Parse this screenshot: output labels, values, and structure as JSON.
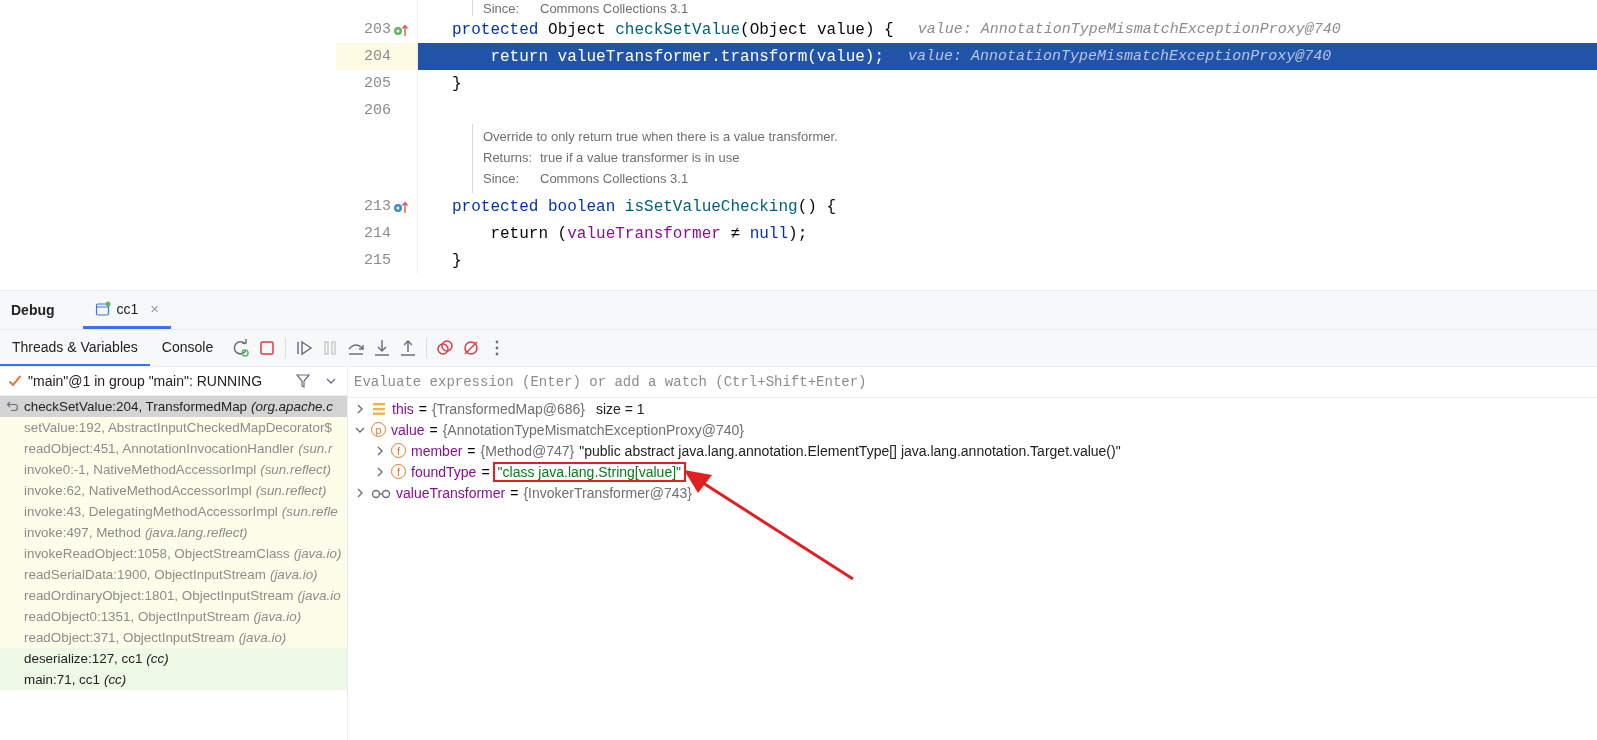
{
  "editor": {
    "lines": [
      {
        "kind": "doc",
        "rows": [
          {
            "label": "Since:",
            "text": "Commons Collections 3.1"
          }
        ]
      },
      {
        "kind": "code",
        "number": "203",
        "marker": {
          "kind": "implements"
        },
        "selected": false,
        "tokens": [
          {
            "text": "protected",
            "kind": "kw"
          },
          {
            "text": " Object ",
            "kind": "plain"
          },
          {
            "text": "checkSetValue",
            "kind": "method"
          },
          {
            "text": "(Object value) {",
            "kind": "plain"
          }
        ],
        "hint": "value: AnnotationTypeMismatchExceptionProxy@740"
      },
      {
        "kind": "code",
        "number": "204",
        "selected": true,
        "tokens": [
          {
            "text": "    return valueTransformer.transform(value);",
            "kind": "plain"
          }
        ],
        "hint": "value: AnnotationTypeMismatchExceptionProxy@740"
      },
      {
        "kind": "code",
        "number": "205",
        "selected": false,
        "tokens": [
          {
            "text": "}",
            "kind": "plain"
          }
        ]
      },
      {
        "kind": "code",
        "number": "206",
        "selected": false
      },
      {
        "kind": "doc",
        "rows": [
          {
            "text": "Override to only return true when there is a value transformer."
          },
          {
            "label": "Returns:",
            "text": "true if a value transformer is in use"
          },
          {
            "label": "Since:",
            "text": "Commons Collections 3.1"
          }
        ]
      },
      {
        "kind": "code",
        "number": "213",
        "marker": {
          "kind": "overrides"
        },
        "selected": false,
        "tokens": [
          {
            "text": "protected boolean",
            "kind": "kw"
          },
          {
            "text": " isSetValueChecking",
            "kind": "method"
          },
          {
            "text": "() {",
            "kind": "plain"
          }
        ]
      },
      {
        "kind": "code",
        "number": "214",
        "selected": false,
        "tokens": [
          {
            "text": "    return (",
            "kind": "plain"
          },
          {
            "text": "valueTransformer",
            "kind": "field"
          },
          {
            "text": " ≠ ",
            "kind": "plain"
          },
          {
            "text": "null",
            "kind": "kw"
          },
          {
            "text": ");",
            "kind": "plain"
          }
        ]
      },
      {
        "kind": "code",
        "number": "215",
        "selected": false,
        "tokens": [
          {
            "text": "}",
            "kind": "plain"
          }
        ]
      }
    ]
  },
  "debug": {
    "title": "Debug",
    "tabs": [
      {
        "label": "cc1",
        "selected": true,
        "close": "×"
      }
    ],
    "subtabs": [
      {
        "label": "Threads & Variables",
        "selected": true
      },
      {
        "label": "Console",
        "selected": false
      }
    ],
    "toolbar": [
      {
        "kind": "rerun",
        "disabled": false
      },
      {
        "kind": "stop",
        "disabled": false
      },
      {
        "kind": "sep"
      },
      {
        "kind": "resume",
        "disabled": false
      },
      {
        "kind": "pause",
        "disabled": true
      },
      {
        "kind": "step-over",
        "disabled": false
      },
      {
        "kind": "step-into",
        "disabled": false
      },
      {
        "kind": "step-out",
        "disabled": false
      },
      {
        "kind": "sep"
      },
      {
        "kind": "breakpoints",
        "disabled": false
      },
      {
        "kind": "mute",
        "disabled": false
      },
      {
        "kind": "more",
        "disabled": false
      }
    ],
    "thread": "\"main\"@1 in group \"main\": RUNNING",
    "frames": [
      {
        "kind": "library",
        "selected": true,
        "text": "checkSetValue:204, TransformedMap",
        "pkg": "(org.apache.c"
      },
      {
        "kind": "library",
        "selected": false,
        "text": "setValue:192, AbstractInputCheckedMapDecorator$"
      },
      {
        "kind": "library",
        "selected": false,
        "text": "readObject:451, AnnotationInvocationHandler",
        "pkg": "(sun.r"
      },
      {
        "kind": "library",
        "selected": false,
        "text": "invoke0:-1, NativeMethodAccessorImpl",
        "pkg": "(sun.reflect)"
      },
      {
        "kind": "library",
        "selected": false,
        "text": "invoke:62, NativeMethodAccessorImpl",
        "pkg": "(sun.reflect)"
      },
      {
        "kind": "library",
        "selected": false,
        "text": "invoke:43, DelegatingMethodAccessorImpl",
        "pkg": "(sun.refle"
      },
      {
        "kind": "library",
        "selected": false,
        "text": "invoke:497, Method",
        "pkg": "(java.lang.reflect)"
      },
      {
        "kind": "library",
        "selected": false,
        "text": "invokeReadObject:1058, ObjectStreamClass",
        "pkg": "(java.io)"
      },
      {
        "kind": "library",
        "selected": false,
        "text": "readSerialData:1900, ObjectInputStream",
        "pkg": "(java.io)"
      },
      {
        "kind": "library",
        "selected": false,
        "text": "readOrdinaryObject:1801, ObjectInputStream",
        "pkg": "(java.io"
      },
      {
        "kind": "library",
        "selected": false,
        "text": "readObject0:1351, ObjectInputStream",
        "pkg": "(java.io)"
      },
      {
        "kind": "library",
        "selected": false,
        "text": "readObject:371, ObjectInputStream",
        "pkg": "(java.io)"
      },
      {
        "kind": "user",
        "selected": false,
        "text": "deserialize:127, cc1",
        "pkg": "(cc)"
      },
      {
        "kind": "user",
        "selected": false,
        "text": "main:71, cc1",
        "pkg": "(cc)"
      }
    ],
    "evaluate": {
      "placeholder": "Evaluate expression (Enter) or add a watch (Ctrl+Shift+Enter)"
    },
    "variables": [
      {
        "kind": "map",
        "name": "this",
        "equals": "=",
        "value": "{TransformedMap@686}",
        "extra": "size = 1",
        "expanded": false
      },
      {
        "kind": "parameter",
        "badge": "p",
        "name": "value",
        "equals": "=",
        "value": "{AnnotationTypeMismatchExceptionProxy@740}",
        "expanded": true,
        "children": [
          {
            "kind": "field",
            "badge": "f",
            "name": "member",
            "equals": "=",
            "value": "{Method@747}",
            "string": {
              "text": "\"public abstract java.lang.annotation.ElementType[] java.lang.annotation.Target.value()\"",
              "kind": "plain"
            },
            "expanded": false
          },
          {
            "kind": "field",
            "badge": "f",
            "name": "foundType",
            "equals": "=",
            "string": {
              "text": "\"class java.lang.String[value]\"",
              "kind": "quoted"
            },
            "highlighted": true,
            "expanded": false
          }
        ]
      },
      {
        "kind": "watch",
        "name": "valueTransformer",
        "equals": "=",
        "value": "{InvokerTransformer@743}",
        "expanded": false
      }
    ]
  }
}
